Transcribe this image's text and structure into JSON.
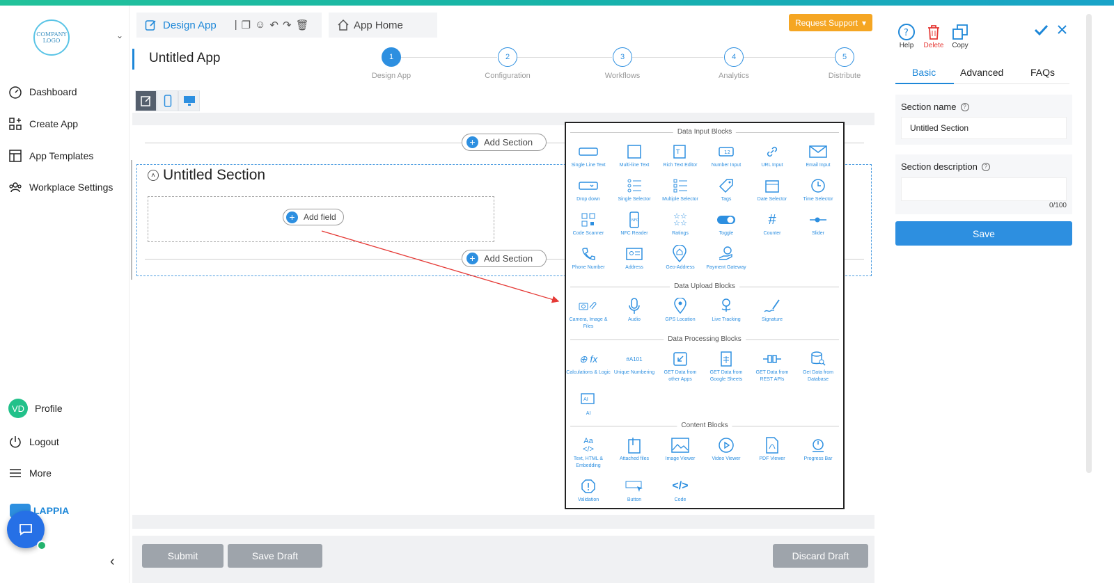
{
  "sidebar": {
    "logo_text": "COMPANY LOGO",
    "nav": [
      {
        "label": "Dashboard",
        "icon": "speedometer-icon"
      },
      {
        "label": "Create App",
        "icon": "grid-plus-icon"
      },
      {
        "label": "App Templates",
        "icon": "template-icon"
      },
      {
        "label": "Workplace Settings",
        "icon": "users-icon"
      }
    ],
    "profile": {
      "initials": "VD",
      "label": "Profile"
    },
    "logout": "Logout",
    "more": "More",
    "brand": "LAPPIA"
  },
  "header": {
    "design_tab": "Design App",
    "home_tab": "App Home",
    "request_support": "Request Support",
    "app_title": "Untitled App",
    "steps": [
      {
        "num": "1",
        "label": "Design App",
        "active": true
      },
      {
        "num": "2",
        "label": "Configuration",
        "active": false
      },
      {
        "num": "3",
        "label": "Workflows",
        "active": false
      },
      {
        "num": "4",
        "label": "Analytics",
        "active": false
      },
      {
        "num": "5",
        "label": "Distribute",
        "active": false
      }
    ]
  },
  "canvas": {
    "add_section": "Add Section",
    "section_title": "Untitled Section",
    "add_field": "Add field"
  },
  "palette": {
    "groups": [
      {
        "title": "Data Input Blocks",
        "blocks": [
          "Single Line Text",
          "Multi-line Text",
          "Rich Text Editor",
          "Number Input",
          "URL Input",
          "Email Input",
          "Drop down",
          "Single Selector",
          "Multiple Selector",
          "Tags",
          "Date Selector",
          "Time Selector",
          "Code Scanner",
          "NFC Reader",
          "Ratings",
          "Toggle",
          "Counter",
          "Slider",
          "Phone Number",
          "Address",
          "Geo-Address",
          "Payment Gateway"
        ]
      },
      {
        "title": "Data Upload Blocks",
        "blocks": [
          "Camera, Image & Files",
          "Audio",
          "GPS Location",
          "Live Tracking",
          "Signature"
        ]
      },
      {
        "title": "Data Processing Blocks",
        "blocks": [
          "Calculations & Logic",
          "Unique Numbering",
          "GET Data from other Apps",
          "GET Data from Google Sheets",
          "GET Data from REST APIs",
          "Get Data from Database",
          "AI"
        ]
      },
      {
        "title": "Content Blocks",
        "blocks": [
          "Text, HTML & Embedding",
          "Attached files",
          "Image Viewer",
          "Video Viewer",
          "PDF Viewer",
          "Progress Bar",
          "Validation",
          "Button",
          "Code"
        ]
      }
    ],
    "unique_numbering_sample": "#A101"
  },
  "footer": {
    "submit": "Submit",
    "save_draft": "Save Draft",
    "discard_draft": "Discard Draft"
  },
  "right_panel": {
    "tools": [
      "Help",
      "Delete",
      "Copy"
    ],
    "tabs": [
      "Basic",
      "Advanced",
      "FAQs"
    ],
    "section_name_label": "Section name",
    "section_name_value": "Untitled Section",
    "section_desc_label": "Section description",
    "char_count": "0/100",
    "save": "Save"
  },
  "colors": {
    "accent": "#2d8fe0",
    "support": "#f5a623",
    "delete": "#e53935",
    "avatar": "#22c18a"
  }
}
